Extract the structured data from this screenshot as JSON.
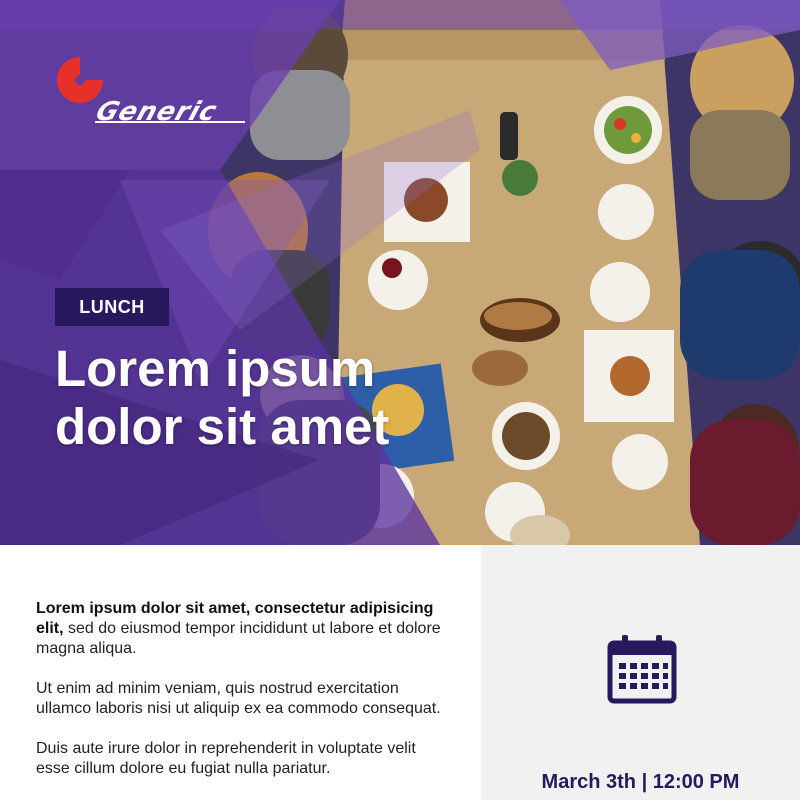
{
  "brand": {
    "name": "Generic",
    "logo_text": "Generic",
    "logo_color": "#e8302a"
  },
  "hero": {
    "tag": "LUNCH",
    "headline_line1": "Lorem ipsum",
    "headline_line2": "dolor sit amet",
    "overlay_color": "#6a4e9e",
    "tag_color": "#28185e"
  },
  "body": {
    "p1_bold": "Lorem ipsum dolor sit amet, consectetur adipisicing elit,",
    "p1_rest": " sed do eiusmod tempor incididunt ut labore et dolore magna aliqua.",
    "p2": "Ut enim ad minim veniam, quis nostrud exercitation ullamco laboris nisi ut aliquip ex ea commodo consequat.",
    "p3": "Duis aute irure dolor in reprehenderit in voluptate velit esse cillum dolore eu fugiat nulla pariatur."
  },
  "event": {
    "icon": "calendar-icon",
    "date_time": "March 3th | 12:00 PM",
    "accent": "#28185e"
  }
}
